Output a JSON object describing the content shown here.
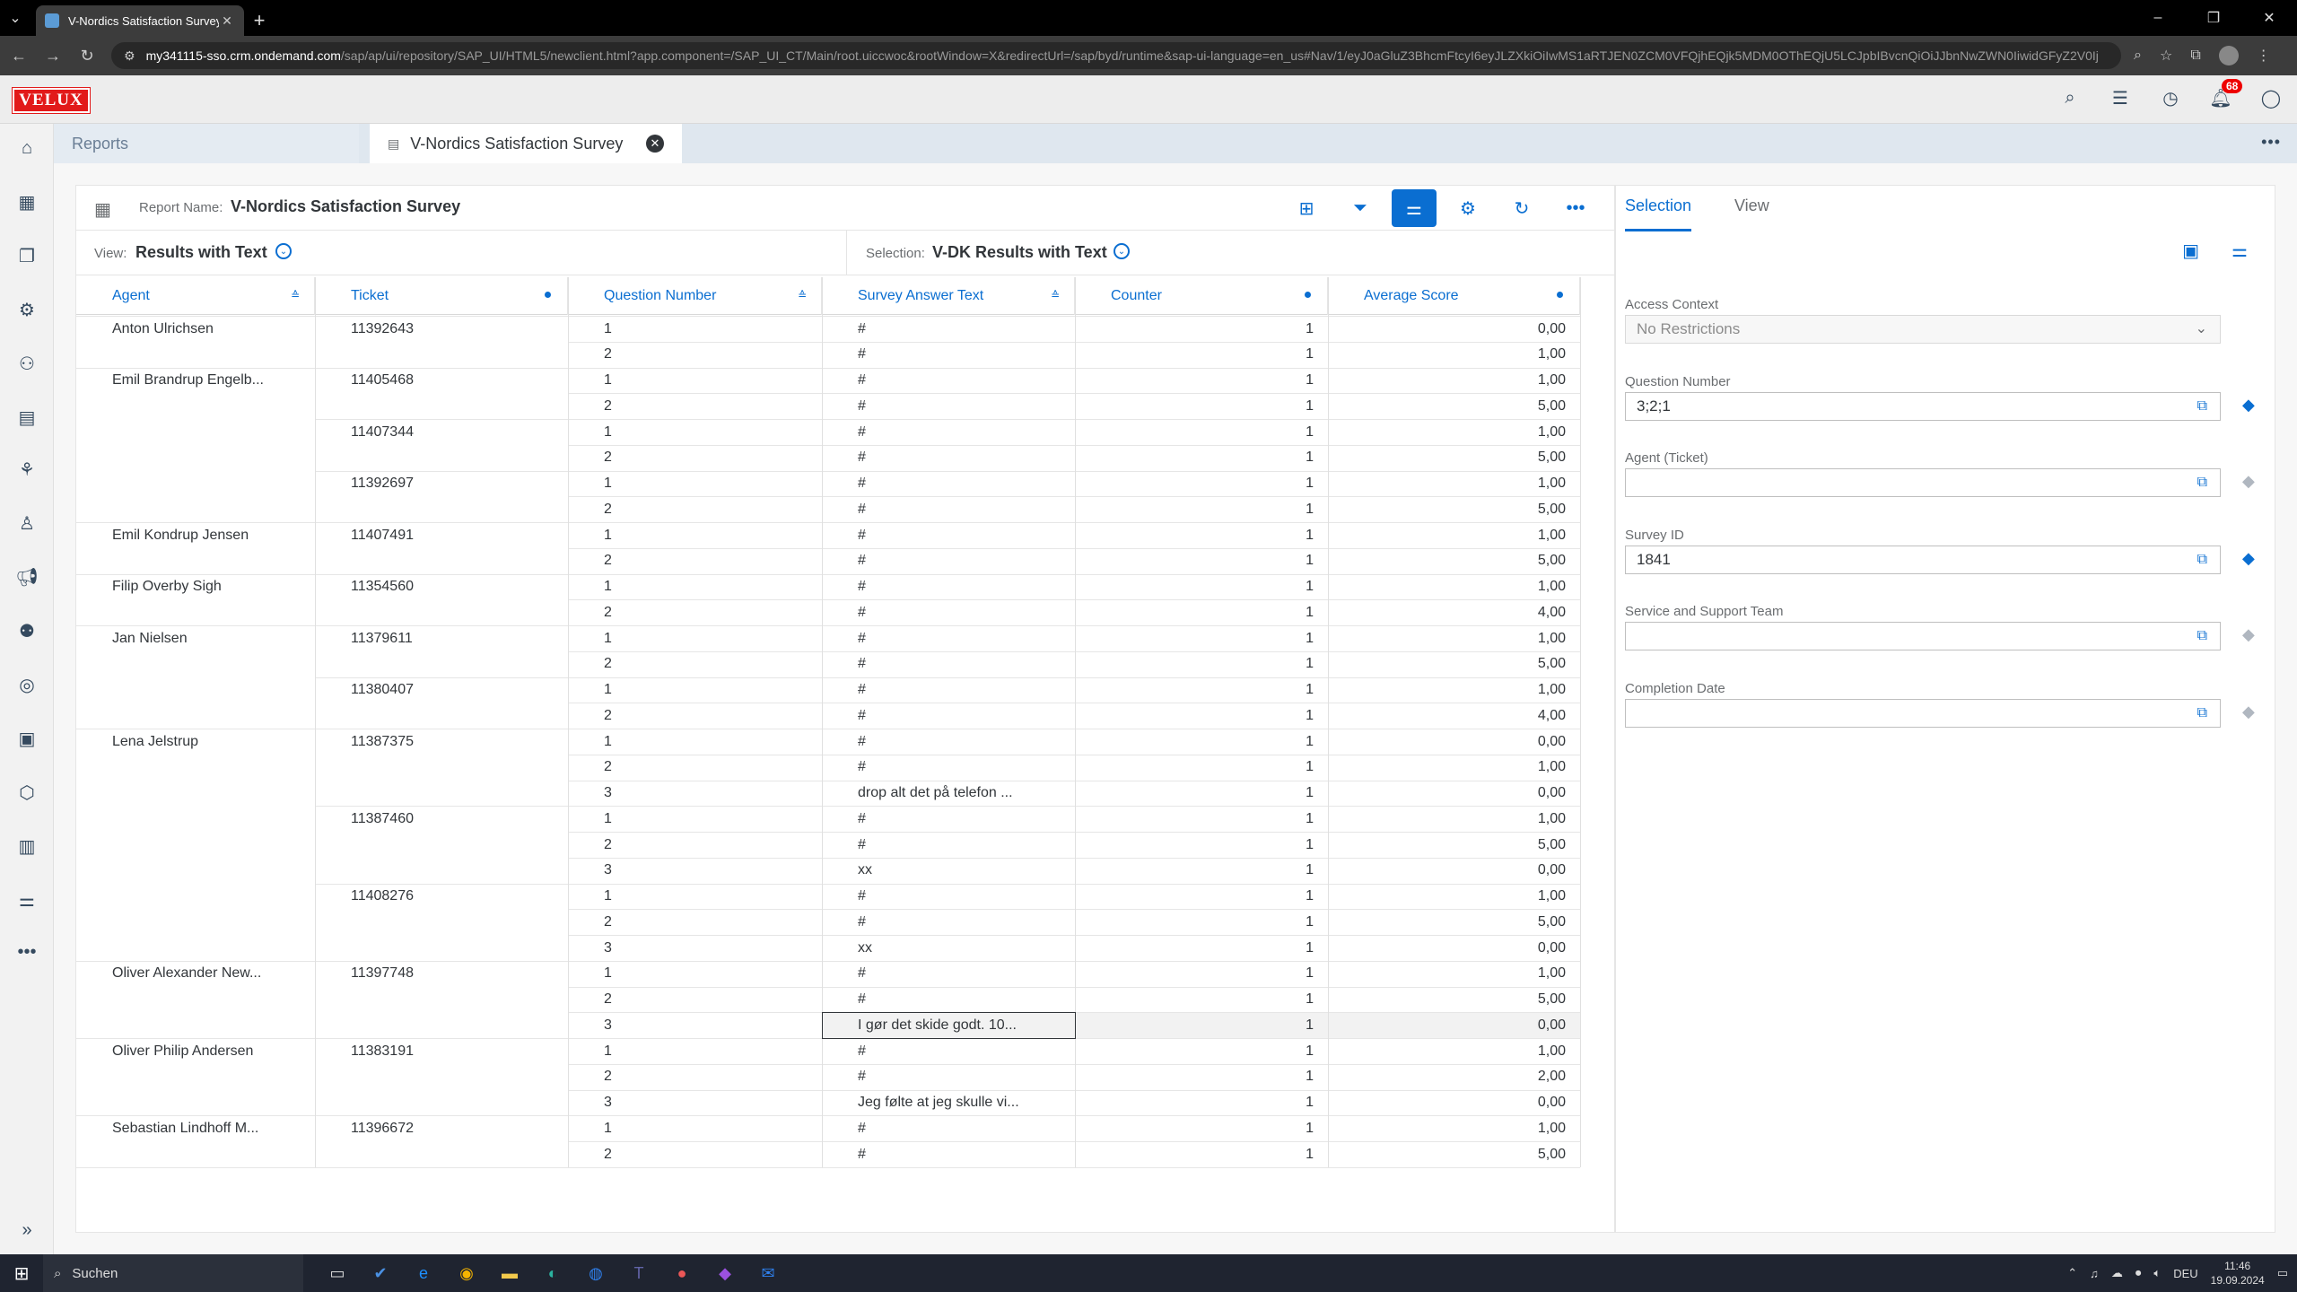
{
  "browser": {
    "tab_title": "V-Nordics Satisfaction Survey -",
    "tab_close": "✕",
    "url_host": "my341115-sso.crm.ondemand.com",
    "url_path": "/sap/ap/ui/repository/SAP_UI/HTML5/newclient.html?app.component=/SAP_UI_CT/Main/root.uiccwoc&rootWindow=X&redirectUrl=/sap/byd/runtime&sap-ui-language=en_us#Nav/1/eyJ0aGluZ3BhcmFtcyI6eyJLZXkiOiIwMS1aRTJEN0ZCM0VFQjhEQjk5MDM0OThEQjU5LCJpbIBvcnQiOiJJbnNwZWN0IiwidGFyZ2V0Ij"
  },
  "shell": {
    "logo": "VELUX",
    "notifications_count": "68"
  },
  "tabs": {
    "reports": "Reports",
    "active": "V-Nordics Satisfaction Survey"
  },
  "report": {
    "name_label": "Report Name:",
    "name": "V-Nordics Satisfaction Survey",
    "view_label": "View:",
    "view_value": "Results with Text",
    "selection_label": "Selection:",
    "selection_value": "V-DK Results with Text"
  },
  "table": {
    "columns": [
      "Agent",
      "Ticket",
      "Question Number",
      "Survey Answer Text",
      "Counter",
      "Average Score"
    ],
    "rows": [
      [
        "Anton Ulrichsen",
        "11392643",
        "1",
        "#",
        "1",
        "0,00"
      ],
      [
        "",
        "",
        "2",
        "#",
        "1",
        "1,00"
      ],
      [
        "Emil Brandrup Engelb...",
        "11405468",
        "1",
        "#",
        "1",
        "1,00"
      ],
      [
        "",
        "",
        "2",
        "#",
        "1",
        "5,00"
      ],
      [
        "",
        "11407344",
        "1",
        "#",
        "1",
        "1,00"
      ],
      [
        "",
        "",
        "2",
        "#",
        "1",
        "5,00"
      ],
      [
        "",
        "11392697",
        "1",
        "#",
        "1",
        "1,00"
      ],
      [
        "",
        "",
        "2",
        "#",
        "1",
        "5,00"
      ],
      [
        "Emil Kondrup Jensen",
        "11407491",
        "1",
        "#",
        "1",
        "1,00"
      ],
      [
        "",
        "",
        "2",
        "#",
        "1",
        "5,00"
      ],
      [
        "Filip Overby Sigh",
        "11354560",
        "1",
        "#",
        "1",
        "1,00"
      ],
      [
        "",
        "",
        "2",
        "#",
        "1",
        "4,00"
      ],
      [
        "Jan Nielsen",
        "11379611",
        "1",
        "#",
        "1",
        "1,00"
      ],
      [
        "",
        "",
        "2",
        "#",
        "1",
        "5,00"
      ],
      [
        "",
        "11380407",
        "1",
        "#",
        "1",
        "1,00"
      ],
      [
        "",
        "",
        "2",
        "#",
        "1",
        "4,00"
      ],
      [
        "Lena Jelstrup",
        "11387375",
        "1",
        "#",
        "1",
        "0,00"
      ],
      [
        "",
        "",
        "2",
        "#",
        "1",
        "1,00"
      ],
      [
        "",
        "",
        "3",
        "drop alt det på telefon ...",
        "1",
        "0,00"
      ],
      [
        "",
        "11387460",
        "1",
        "#",
        "1",
        "1,00"
      ],
      [
        "",
        "",
        "2",
        "#",
        "1",
        "5,00"
      ],
      [
        "",
        "",
        "3",
        "xx",
        "1",
        "0,00"
      ],
      [
        "",
        "11408276",
        "1",
        "#",
        "1",
        "1,00"
      ],
      [
        "",
        "",
        "2",
        "#",
        "1",
        "5,00"
      ],
      [
        "",
        "",
        "3",
        "xx",
        "1",
        "0,00"
      ],
      [
        "Oliver Alexander New...",
        "11397748",
        "1",
        "#",
        "1",
        "1,00"
      ],
      [
        "",
        "",
        "2",
        "#",
        "1",
        "5,00"
      ],
      [
        "",
        "",
        "3",
        "I gør det skide godt. 10...",
        "1",
        "0,00"
      ],
      [
        "Oliver Philip Andersen",
        "11383191",
        "1",
        "#",
        "1",
        "1,00"
      ],
      [
        "",
        "",
        "2",
        "#",
        "1",
        "2,00"
      ],
      [
        "",
        "",
        "3",
        "Jeg følte at jeg skulle vi...",
        "1",
        "0,00"
      ],
      [
        "Sebastian Lindhoff M...",
        "11396672",
        "1",
        "#",
        "1",
        "1,00"
      ],
      [
        "",
        "",
        "2",
        "#",
        "1",
        "5,00"
      ]
    ],
    "highlight_row": 27
  },
  "selection_panel": {
    "tab_selection": "Selection",
    "tab_view": "View",
    "fields": [
      {
        "label": "Access Context",
        "value": "No Restrictions",
        "type": "dropdown"
      },
      {
        "label": "Question Number",
        "value": "3;2;1",
        "eraser": true
      },
      {
        "label": "Agent (Ticket)",
        "value": "",
        "eraser": false
      },
      {
        "label": "Survey ID",
        "value": "1841",
        "eraser": true
      },
      {
        "label": "Service and Support Team",
        "value": "",
        "eraser": false
      },
      {
        "label": "Completion Date",
        "value": "",
        "eraser": false
      }
    ]
  },
  "taskbar": {
    "search": "Suchen",
    "lang": "DEU",
    "time": "11:46",
    "date": "19.09.2024"
  }
}
